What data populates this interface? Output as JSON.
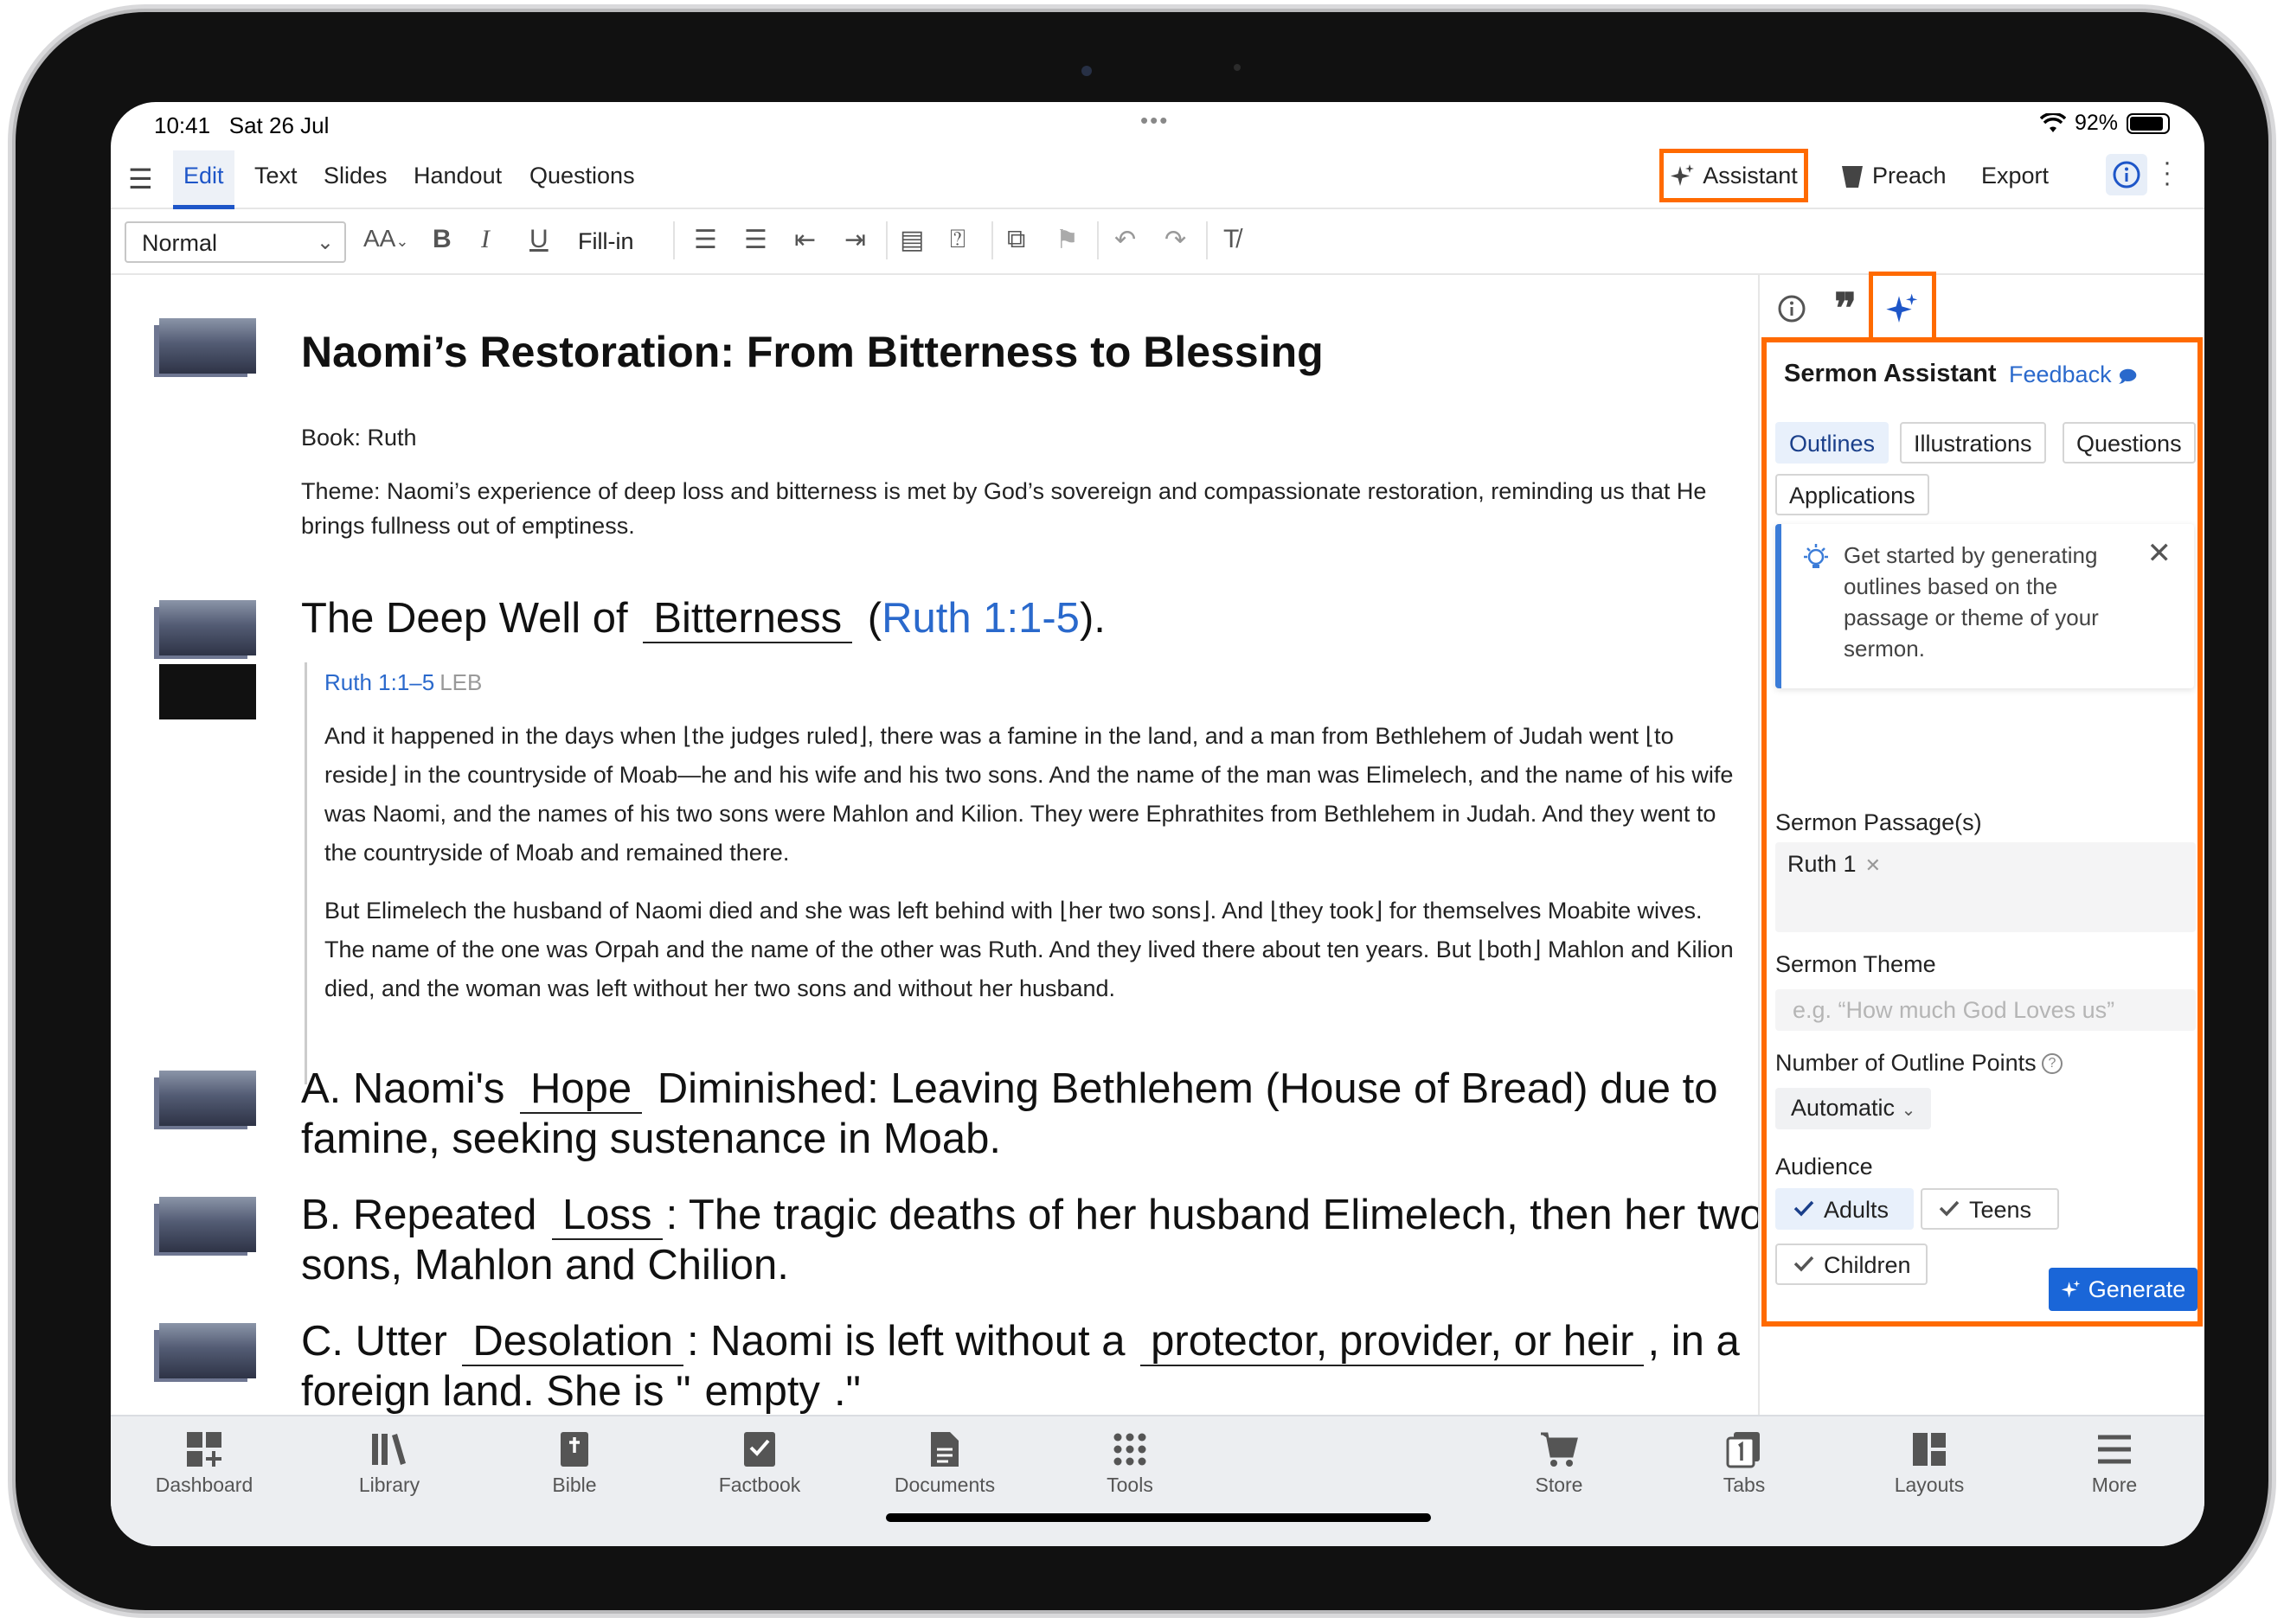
{
  "status": {
    "time": "10:41",
    "date": "Sat 26 Jul",
    "battery": "92%"
  },
  "menu": {
    "tabs": [
      "Edit",
      "Text",
      "Slides",
      "Handout",
      "Questions"
    ],
    "assistant": "Assistant",
    "preach": "Preach",
    "export": "Export"
  },
  "toolbar": {
    "style": "Normal",
    "fill_in": "Fill-in"
  },
  "doc": {
    "title": "Naomi’s Restoration: From Bitterness to Blessing",
    "book": "Book: Ruth",
    "theme": "Theme: Naomi’s experience of deep loss and bitterness is met by God’s sovereign and compassionate restoration, reminding us that He brings fullness out of emptiness.",
    "h1": {
      "pre": "The Deep Well of",
      "blank": "Bitterness",
      "open": "(",
      "ref": "Ruth 1:1-5",
      "close": ")."
    },
    "quote": {
      "ref": "Ruth 1:1–5",
      "version": "LEB",
      "p1": "And it happened in the days when ⌊the judges ruled⌋, there was a famine in the land, and a man from Bethlehem of Judah went ⌊to reside⌋ in the countryside of Moab—he and his wife and his two sons. And the name of the man was Elimelech, and the name of his wife was Naomi, and the names of his two sons were Mahlon and Kilion. They were Ephrathites from Bethlehem in Judah. And they went to the countryside of Moab and remained there.",
      "p2": "But Elimelech the husband of Naomi died and she was left behind with ⌊her two sons⌋. And ⌊they took⌋ for themselves Moabite wives. The name of the one was Orpah and the name of the other was Ruth. And they lived there about ten years. But ⌊both⌋ Mahlon and Kilion died, and the woman was left without her two sons and without her husband."
    },
    "pointA": {
      "pre": "A. Naomi's",
      "blank": "Hope",
      "post": "Diminished: Leaving Bethlehem (House of Bread) due to famine, seeking sustenance in Moab."
    },
    "pointB": {
      "pre": "B. Repeated",
      "blank": "Loss",
      "post": ": The tragic deaths of her husband Elimelech, then her two sons, Mahlon and Chilion."
    },
    "pointC": {
      "pre": "C. Utter",
      "blank": "Desolation",
      "mid": ": Naomi is left without a",
      "blank2": "protector, provider, or heir",
      "post": ", in a foreign land. She is \"",
      "blank3": "empty",
      "end": ".\""
    }
  },
  "assistant": {
    "title": "Sermon Assistant",
    "feedback": "Feedback",
    "tabs": [
      "Outlines",
      "Illustrations",
      "Questions",
      "Applications"
    ],
    "tip": "Get started by generating outlines based on the passage or theme of your sermon.",
    "passage_label": "Sermon Passage(s)",
    "passage_chip": "Ruth 1",
    "theme_label": "Sermon Theme",
    "theme_placeholder": "e.g. “How much God Loves us”",
    "points_label": "Number of Outline Points",
    "points_value": "Automatic",
    "audience_label": "Audience",
    "audience": [
      "Adults",
      "Teens",
      "Children"
    ],
    "generate": "Generate"
  },
  "nav": [
    "Dashboard",
    "Library",
    "Bible",
    "Factbook",
    "Documents",
    "Tools",
    "Store",
    "Tabs",
    "Layouts",
    "More"
  ],
  "colors": {
    "accent": "#1a66d8",
    "highlight": "#ff6a00",
    "link": "#2a69cc"
  }
}
